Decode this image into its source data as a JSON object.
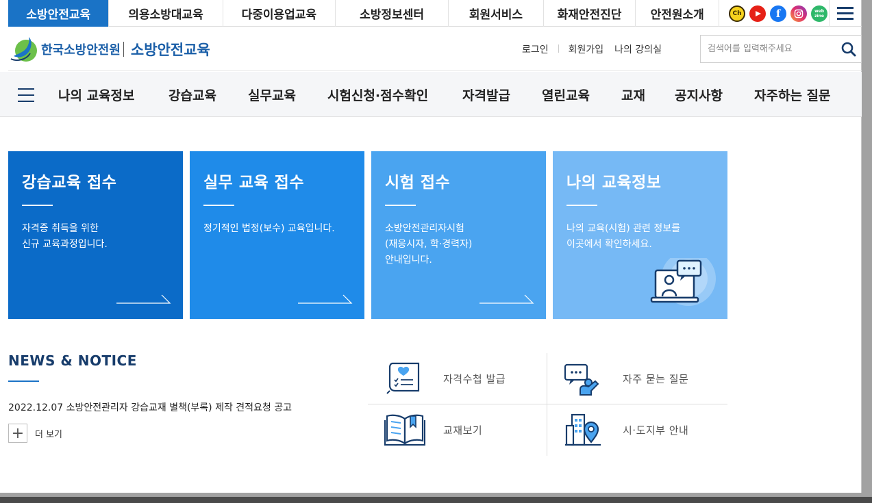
{
  "colors": {
    "brand_blue": "#1a73c6",
    "navy": "#173c6b",
    "card1": "#0b6bc8",
    "card2": "#1f8be9",
    "card3": "#4aa4f0",
    "card4": "#76b9f5"
  },
  "topbar": {
    "tabs": [
      {
        "label": "소방안전교육",
        "active": true
      },
      {
        "label": "의용소방대교육",
        "active": false
      },
      {
        "label": "다중이용업교육",
        "active": false
      },
      {
        "label": "소방정보센터",
        "active": false
      },
      {
        "label": "회원서비스",
        "active": false
      },
      {
        "label": "화재안전진단",
        "active": false
      },
      {
        "label": "안전원소개",
        "active": false
      }
    ],
    "social_icons": [
      "kakao-channel-icon",
      "youtube-icon",
      "facebook-icon",
      "instagram-icon",
      "webzine-icon"
    ],
    "social_texts": {
      "kakao": "Ch",
      "webzine": "web zine"
    }
  },
  "header": {
    "org_name": "한국소방안전원",
    "site_name": "소방안전교육",
    "links": [
      "로그인",
      "회원가입",
      "나의 강의실"
    ],
    "search_placeholder": "검색어를 입력해주세요"
  },
  "nav": {
    "items": [
      "나의 교육정보",
      "강습교육",
      "실무교육",
      "시험신청·점수확인",
      "자격발급",
      "열린교육",
      "교재",
      "공지사항",
      "자주하는 질문"
    ]
  },
  "cards": [
    {
      "title": "강습교육 접수",
      "lines": [
        "자격증 취득을 위한",
        "신규 교육과정입니다."
      ]
    },
    {
      "title": "실무 교육 접수",
      "lines": [
        "정기적인 법정(보수) 교육입니다."
      ]
    },
    {
      "title": "시험 접수",
      "lines": [
        "소방안전관리자시험",
        "(재응시자, 학·경력자)",
        "안내입니다."
      ]
    },
    {
      "title": "나의 교육정보",
      "lines": [
        "나의 교육(시험) 관련 정보를",
        "이곳에서 확인하세요."
      ]
    }
  ],
  "news": {
    "title": "NEWS & NOTICE",
    "item": "2022.12.07 소방안전관리자 강습교재 별책(부록) 제작 견적요청 공고",
    "more": "더 보기"
  },
  "quick_links": [
    {
      "label": "자격수첩 발급",
      "icon": "certificate-icon"
    },
    {
      "label": "자주 묻는 질문",
      "icon": "faq-person-icon"
    },
    {
      "label": "교재보기",
      "icon": "open-book-icon"
    },
    {
      "label": "시·도지부 안내",
      "icon": "building-location-icon"
    }
  ]
}
